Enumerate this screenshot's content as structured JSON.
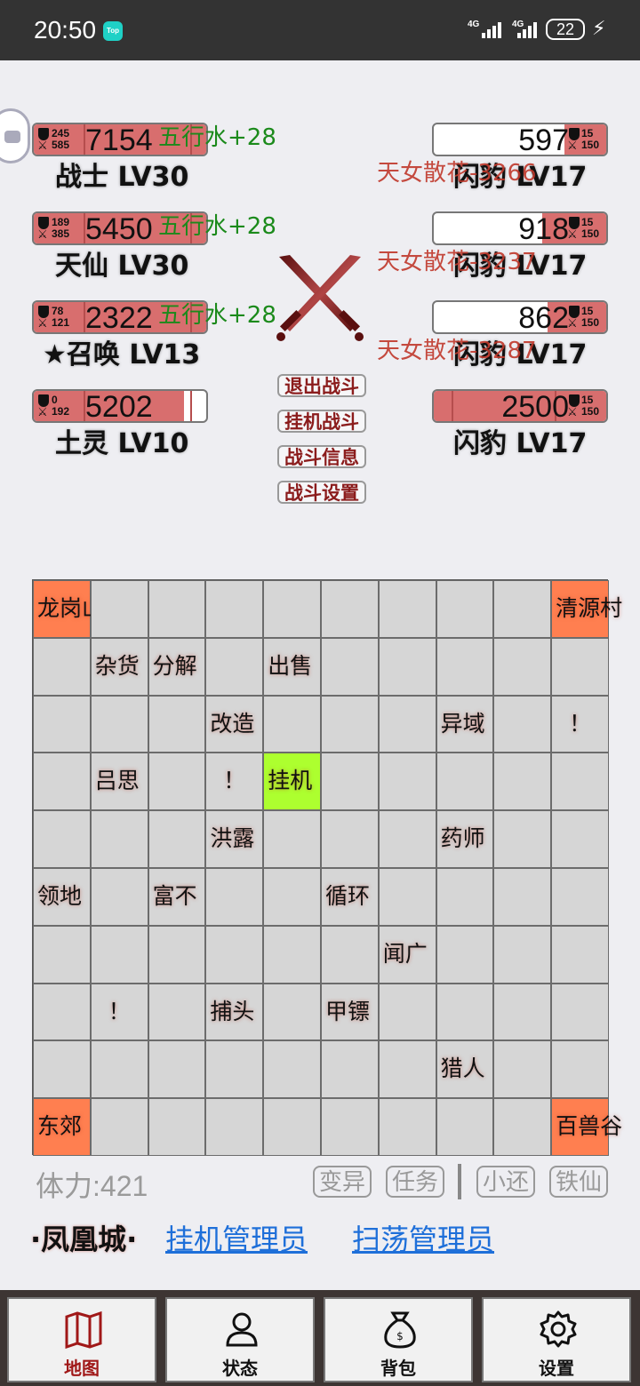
{
  "status_bar": {
    "time": "20:50",
    "app_badge": "Top",
    "net1": "4G",
    "net2": "4G",
    "battery": "22"
  },
  "allies": [
    {
      "hp": "7154",
      "stat_top": "245",
      "stat_bottom": "585",
      "name": "战士 LV30",
      "bonus": "五行水+28",
      "hp_fraction": 1.0
    },
    {
      "hp": "5450",
      "stat_top": "189",
      "stat_bottom": "385",
      "name": "天仙 LV30",
      "bonus": "五行水+28",
      "hp_fraction": 1.0
    },
    {
      "hp": "2322",
      "stat_top": "78",
      "stat_bottom": "121",
      "name": "★召唤 LV13",
      "bonus": "五行水+28",
      "hp_fraction": 1.0
    },
    {
      "hp": "5202",
      "stat_top": "0",
      "stat_bottom": "192",
      "name": "土灵 LV10",
      "bonus": "",
      "hp_fraction": 0.87
    }
  ],
  "enemies": [
    {
      "hp": "597",
      "stat_top": "15",
      "stat_bottom": "150",
      "name": "闪豹 LV17",
      "overlay": "天女散花-3266",
      "hp_fraction": 0.24
    },
    {
      "hp": "918",
      "stat_top": "15",
      "stat_bottom": "150",
      "name": "闪豹 LV17",
      "overlay": "天女散花-3237",
      "hp_fraction": 0.37
    },
    {
      "hp": "862",
      "stat_top": "15",
      "stat_bottom": "150",
      "name": "闪豹 LV17",
      "overlay": "天女散花-3287",
      "hp_fraction": 0.34
    },
    {
      "hp": "2500",
      "stat_top": "15",
      "stat_bottom": "150",
      "name": "闪豹 LV17",
      "overlay": "",
      "hp_fraction": 1.0
    }
  ],
  "battle_buttons": [
    "退出战斗",
    "挂机战斗",
    "战斗信息",
    "战斗设置"
  ],
  "map": {
    "cells": [
      {
        "row": 0,
        "col": 0,
        "text": "龙岗山",
        "type": "corner"
      },
      {
        "row": 0,
        "col": 9,
        "text": "清源村",
        "type": "corner"
      },
      {
        "row": 1,
        "col": 1,
        "text": "杂货",
        "type": "npc"
      },
      {
        "row": 1,
        "col": 2,
        "text": "分解",
        "type": "npc"
      },
      {
        "row": 1,
        "col": 4,
        "text": "出售",
        "type": "npc"
      },
      {
        "row": 2,
        "col": 3,
        "text": "改造",
        "type": "npc"
      },
      {
        "row": 2,
        "col": 7,
        "text": "异域",
        "type": "npc"
      },
      {
        "row": 2,
        "col": 9,
        "text": "！",
        "type": "mark"
      },
      {
        "row": 3,
        "col": 1,
        "text": "吕思",
        "type": "npc"
      },
      {
        "row": 3,
        "col": 3,
        "text": "！",
        "type": "mark"
      },
      {
        "row": 3,
        "col": 4,
        "text": "挂机",
        "type": "active"
      },
      {
        "row": 4,
        "col": 3,
        "text": "洪露",
        "type": "npc"
      },
      {
        "row": 4,
        "col": 7,
        "text": "药师",
        "type": "npc"
      },
      {
        "row": 5,
        "col": 0,
        "text": "领地",
        "type": "npc"
      },
      {
        "row": 5,
        "col": 2,
        "text": "富不",
        "type": "npc"
      },
      {
        "row": 5,
        "col": 5,
        "text": "循环",
        "type": "npc"
      },
      {
        "row": 6,
        "col": 6,
        "text": "闻广",
        "type": "npc"
      },
      {
        "row": 7,
        "col": 1,
        "text": "！",
        "type": "mark"
      },
      {
        "row": 7,
        "col": 3,
        "text": "捕头",
        "type": "npc"
      },
      {
        "row": 7,
        "col": 5,
        "text": "甲镖",
        "type": "npc"
      },
      {
        "row": 8,
        "col": 7,
        "text": "猎人",
        "type": "npc"
      },
      {
        "row": 9,
        "col": 0,
        "text": "东郊",
        "type": "corner"
      },
      {
        "row": 9,
        "col": 9,
        "text": "百兽谷",
        "type": "corner"
      }
    ]
  },
  "footer": {
    "stamina": "体力:421",
    "buttons": [
      "变异",
      "任务",
      "小还",
      "铁仙"
    ],
    "city": "·凤凰城·",
    "link1": "挂机管理员",
    "link2": "扫荡管理员"
  },
  "nav": {
    "tabs": [
      {
        "label": "地图",
        "icon": "map-icon",
        "active": true
      },
      {
        "label": "状态",
        "icon": "person-icon",
        "active": false
      },
      {
        "label": "背包",
        "icon": "bag-icon",
        "active": false
      },
      {
        "label": "设置",
        "icon": "gear-icon",
        "active": false
      }
    ]
  },
  "colors": {
    "hp_fill": "#d86e6e",
    "corner_cell": "#ff7f50",
    "active_cell": "#adff2f",
    "link": "#1e6fd9",
    "bonus_green": "#1b8a1b",
    "damage_red": "#c0382b",
    "button_text": "#8b1c1c"
  }
}
